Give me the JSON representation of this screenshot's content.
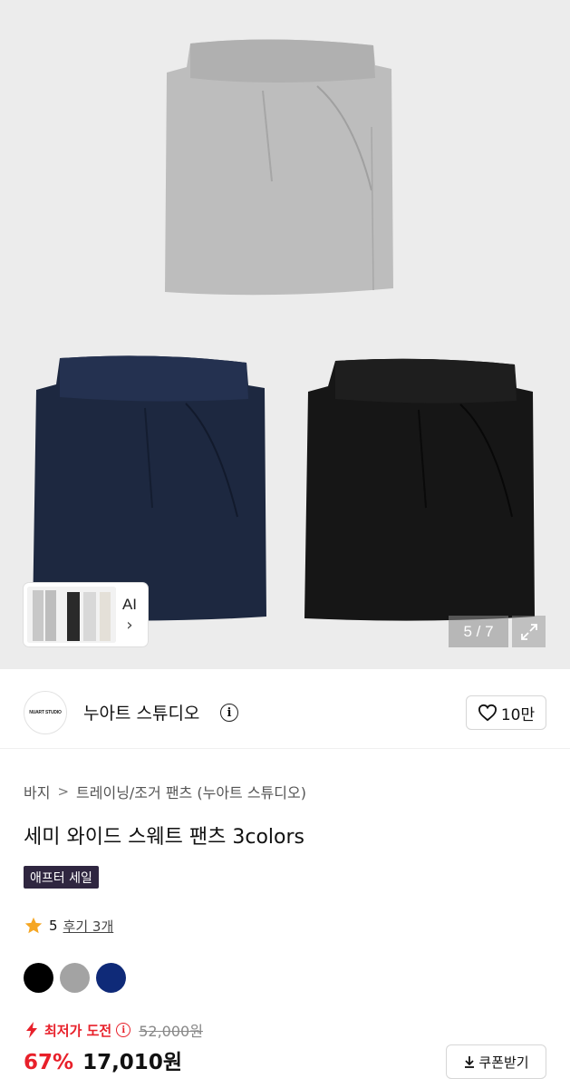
{
  "gallery": {
    "ai_label": "AI",
    "ai_chevron": "›",
    "counter": "5 / 7",
    "pants_colors": {
      "gray": "#bdbdbd",
      "navy": "#1d2840",
      "black": "#161616"
    }
  },
  "brand": {
    "logo_text": "NUART STUDIO",
    "name": "누아트 스튜디오",
    "info_icon": "i",
    "like_count": "10만"
  },
  "breadcrumb": {
    "items": [
      "바지",
      "트레이닝/조거 팬츠 (누아트 스튜디오)"
    ],
    "separator": ">"
  },
  "product": {
    "title": "세미 와이드 스웨트 팬츠 3colors",
    "badge": "애프터 세일",
    "rating": "5",
    "review_link": "후기 3개",
    "swatches": [
      "#000000",
      "#a3a3a3",
      "#0f2a78"
    ],
    "lowest_label": "최저가 도전",
    "lowest_info": "i",
    "original_price": "52,000원",
    "discount": "67%",
    "price": "17,010원",
    "coupon_label": "쿠폰받기"
  },
  "colors": {
    "accent_red": "#e8202a",
    "badge_bg": "#2f2640",
    "star": "#f5a623"
  }
}
